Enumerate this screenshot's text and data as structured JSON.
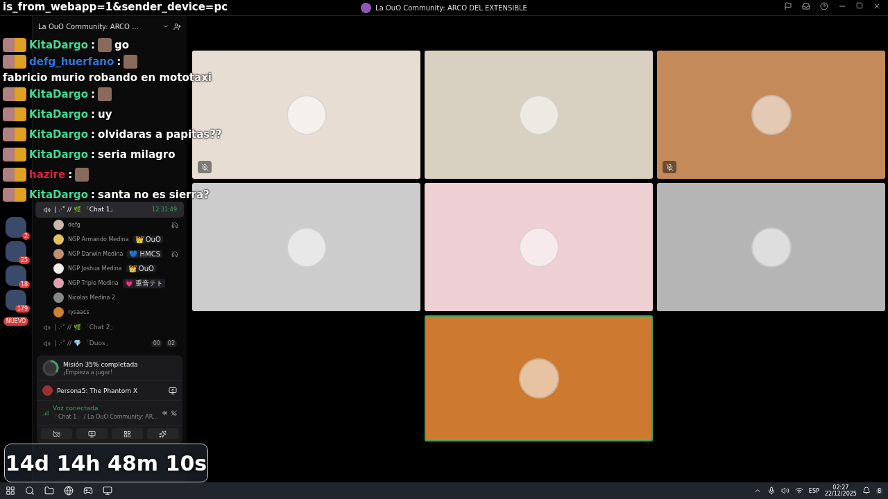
{
  "url_overlay": "is_from_webapp=1&sender_device=pc",
  "window": {
    "title": "La OuO Community: ARCO DEL EXTENSIBLE"
  },
  "servers": [
    {
      "badge": "2"
    },
    {
      "badge": "25"
    },
    {
      "badge": "18"
    },
    {
      "badge": "179"
    }
  ],
  "new_label": "NUEVO",
  "server_name": "La OuO Community: ARCO ...",
  "voice_channels": [
    {
      "name": "| .·˚ // 🌿 「Chat 1」",
      "time": "12:31:49",
      "selected": true,
      "users": [
        {
          "name": "defg",
          "muted": true
        },
        {
          "name": "NGP Armando Medina",
          "tag": "👑 OuO",
          "muted": false
        },
        {
          "name": "NGP Darwin Medina",
          "tag": "💙 HMCS",
          "muted": true
        },
        {
          "name": "NGP Joshua Medina",
          "tag": "👑 OuO",
          "muted": false
        },
        {
          "name": "NGP Triple Medina",
          "tag": "💗 重音テト",
          "muted": false
        },
        {
          "name": "Nicolas Medina 2",
          "muted": false
        },
        {
          "name": "rysaacs",
          "muted": false
        }
      ]
    },
    {
      "name": "| .·˚ // 🌿 「Chat 2」",
      "selected": false
    },
    {
      "name": "| .·˚ // 💎 「Duos」",
      "counts": [
        "00",
        "02"
      ],
      "selected": false
    }
  ],
  "mission": {
    "title": "Misión 35% completada",
    "subtitle": "¡Empieza a jugar!",
    "level": 0.35
  },
  "activity": {
    "game": "Persona5: The Phantom X"
  },
  "voice": {
    "status": "Voz conectada",
    "channel": "「Chat 1」 / La OuO Community: AR..."
  },
  "chat": [
    {
      "user": "KitaDargo",
      "color": "#3ddc97",
      "sep": ":",
      "text": "go",
      "emote": true
    },
    {
      "user": "defg_huerfano",
      "color": "#2a7ae2",
      "sep": ":",
      "text": "fabricio murio robando en mototaxi",
      "emote": true
    },
    {
      "user": "KitaDargo",
      "color": "#3ddc97",
      "sep": ":",
      "emote": true
    },
    {
      "user": "KitaDargo",
      "color": "#3ddc97",
      "sep": ":",
      "text": "uy",
      "emote": false
    },
    {
      "user": "KitaDargo",
      "color": "#3ddc97",
      "sep": ":",
      "text": "olvidaras a papitas??",
      "emote": false
    },
    {
      "user": "KitaDargo",
      "color": "#3ddc97",
      "sep": ":",
      "text": "seria milagro",
      "emote": false
    },
    {
      "user": "hazire",
      "color": "#e02040",
      "sep": ":",
      "emote": true
    },
    {
      "user": "KitaDargo",
      "color": "#3ddc97",
      "sep": ":",
      "text": "santa no es sierra?",
      "emote": false
    }
  ],
  "tiles": [
    {
      "color": "#e8ddd2",
      "muted": true,
      "speaking": false
    },
    {
      "color": "#d8d0c0",
      "muted": false,
      "speaking": false
    },
    {
      "color": "#c48a5a",
      "muted": true,
      "speaking": false
    },
    {
      "color": "#cccccc",
      "muted": false,
      "speaking": false
    },
    {
      "color": "#eed0d4",
      "muted": false,
      "speaking": false
    },
    {
      "color": "#b5b5b5",
      "muted": false,
      "speaking": false
    },
    {
      "color": "#cd7a30",
      "muted": false,
      "speaking": true
    }
  ],
  "timer": "14d 14h 48m 10s",
  "taskbar": {
    "language": "ESP",
    "time": "02:27",
    "date": "22/12/2025",
    "notifications": "8"
  }
}
